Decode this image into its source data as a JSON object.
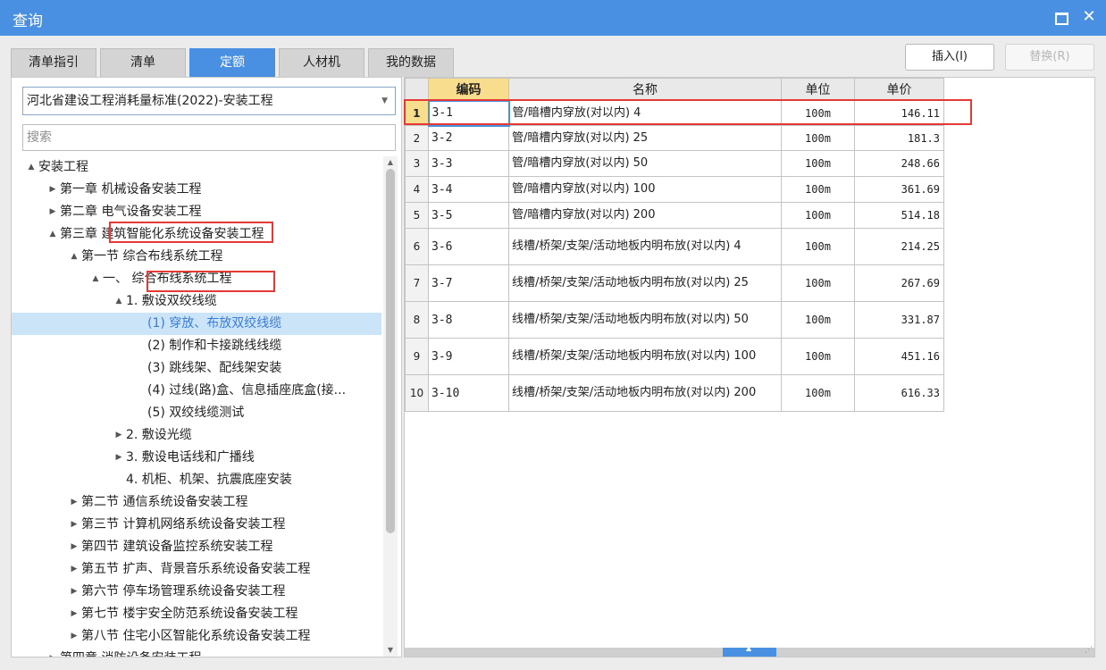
{
  "window": {
    "title": "查询",
    "maximize_icon": "maximize-icon",
    "close_icon": "close-icon",
    "close_glyph": "✕"
  },
  "colors": {
    "accent": "#4a90e2",
    "highlight": "#e53935",
    "header_active": "#f9dd8f",
    "selection": "#cce4f7"
  },
  "tabs": [
    {
      "label": "清单指引",
      "active": false
    },
    {
      "label": "清单",
      "active": false
    },
    {
      "label": "定额",
      "active": true
    },
    {
      "label": "人材机",
      "active": false
    },
    {
      "label": "我的数据",
      "active": false
    }
  ],
  "buttons": {
    "insert": "插入(I)",
    "replace": "替换(R)"
  },
  "library": {
    "selected": "河北省建设工程消耗量标准(2022)-安装工程"
  },
  "search": {
    "placeholder": "搜索"
  },
  "tree": [
    {
      "label": "安装工程",
      "toggle": "▲",
      "selected": false
    },
    {
      "label": "第一章 机械设备安装工程",
      "toggle": "▶",
      "selected": false
    },
    {
      "label": "第二章 电气设备安装工程",
      "toggle": "▶",
      "selected": false
    },
    {
      "label": "第三章 建筑智能化系统设备安装工程",
      "toggle": "▲",
      "selected": false
    },
    {
      "label": "第一节 综合布线系统工程",
      "toggle": "▲",
      "selected": false
    },
    {
      "label": "一、  综合布线系统工程",
      "toggle": "▲",
      "selected": false
    },
    {
      "label": "1. 敷设双绞线缆",
      "toggle": "▲",
      "selected": false
    },
    {
      "label": "(1) 穿放、布放双绞线缆",
      "toggle": "",
      "selected": true
    },
    {
      "label": "(2) 制作和卡接跳线线缆",
      "toggle": "",
      "selected": false
    },
    {
      "label": "(3) 跳线架、配线架安装",
      "toggle": "",
      "selected": false
    },
    {
      "label": "(4) 过线(路)盒、信息插座底盒(接...",
      "toggle": "",
      "selected": false
    },
    {
      "label": "(5) 双绞线缆测试",
      "toggle": "",
      "selected": false
    },
    {
      "label": "2. 敷设光缆",
      "toggle": "▶",
      "selected": false
    },
    {
      "label": "3. 敷设电话线和广播线",
      "toggle": "▶",
      "selected": false
    },
    {
      "label": "4. 机柜、机架、抗震底座安装",
      "toggle": "",
      "selected": false
    },
    {
      "label": "第二节 通信系统设备安装工程",
      "toggle": "▶",
      "selected": false
    },
    {
      "label": "第三节 计算机网络系统设备安装工程",
      "toggle": "▶",
      "selected": false
    },
    {
      "label": "第四节 建筑设备监控系统安装工程",
      "toggle": "▶",
      "selected": false
    },
    {
      "label": "第五节 扩声、背景音乐系统设备安装工程",
      "toggle": "▶",
      "selected": false
    },
    {
      "label": "第六节 停车场管理系统设备安装工程",
      "toggle": "▶",
      "selected": false
    },
    {
      "label": "第七节 楼宇安全防范系统设备安装工程",
      "toggle": "▶",
      "selected": false
    },
    {
      "label": "第八节 住宅小区智能化系统设备安装工程",
      "toggle": "▶",
      "selected": false
    },
    {
      "label": "第四章 消防设备安装工程",
      "toggle": "▶",
      "selected": false
    }
  ],
  "table": {
    "columns": [
      "编码",
      "名称",
      "单位",
      "单价"
    ],
    "rows": [
      {
        "num": "1",
        "code": "3-1",
        "name": "管/暗槽内穿放(对以内) 4",
        "unit": "100m",
        "price": "146.11"
      },
      {
        "num": "2",
        "code": "3-2",
        "name": "管/暗槽内穿放(对以内) 25",
        "unit": "100m",
        "price": "181.3"
      },
      {
        "num": "3",
        "code": "3-3",
        "name": "管/暗槽内穿放(对以内) 50",
        "unit": "100m",
        "price": "248.66"
      },
      {
        "num": "4",
        "code": "3-4",
        "name": "管/暗槽内穿放(对以内) 100",
        "unit": "100m",
        "price": "361.69"
      },
      {
        "num": "5",
        "code": "3-5",
        "name": "管/暗槽内穿放(对以内) 200",
        "unit": "100m",
        "price": "514.18"
      },
      {
        "num": "6",
        "code": "3-6",
        "name": "线槽/桥架/支架/活动地板内明布放(对以内) 4",
        "unit": "100m",
        "price": "214.25"
      },
      {
        "num": "7",
        "code": "3-7",
        "name": "线槽/桥架/支架/活动地板内明布放(对以内) 25",
        "unit": "100m",
        "price": "267.69"
      },
      {
        "num": "8",
        "code": "3-8",
        "name": "线槽/桥架/支架/活动地板内明布放(对以内) 50",
        "unit": "100m",
        "price": "331.87"
      },
      {
        "num": "9",
        "code": "3-9",
        "name": "线槽/桥架/支架/活动地板内明布放(对以内) 100",
        "unit": "100m",
        "price": "451.16"
      },
      {
        "num": "10",
        "code": "3-10",
        "name": "线槽/桥架/支架/活动地板内明布放(对以内) 200",
        "unit": "100m",
        "price": "616.33"
      }
    ]
  }
}
